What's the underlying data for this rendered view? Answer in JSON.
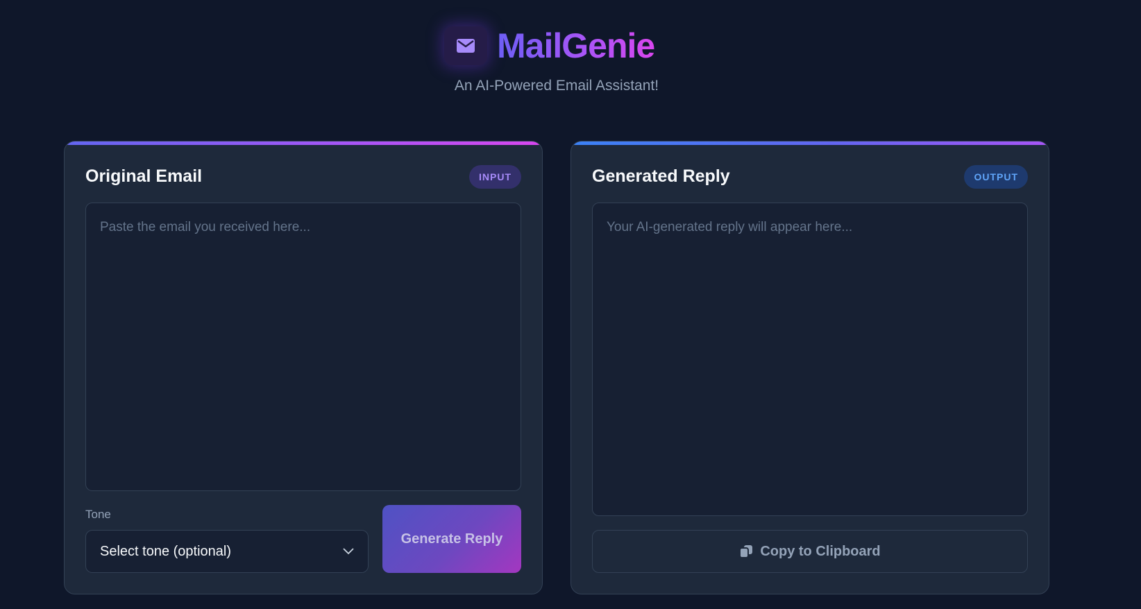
{
  "app": {
    "title": "MailGenie",
    "subtitle": "An AI-Powered Email Assistant!"
  },
  "input_card": {
    "title": "Original Email",
    "badge": "INPUT",
    "placeholder": "Paste the email you received here...",
    "tone_label": "Tone",
    "tone_selected": "Select tone (optional)",
    "generate_label": "Generate Reply"
  },
  "output_card": {
    "title": "Generated Reply",
    "badge": "OUTPUT",
    "placeholder": "Your AI-generated reply will appear here...",
    "copy_label": "Copy to Clipboard"
  },
  "icons": {
    "logo": "envelope-icon",
    "select": "chevron-down-icon",
    "copy": "copy-icon"
  },
  "colors": {
    "background": "#0f172a",
    "card": "#1e293b",
    "accent_purple": "#a855f7",
    "accent_blue": "#3b82f6",
    "accent_pink": "#d946ef"
  }
}
